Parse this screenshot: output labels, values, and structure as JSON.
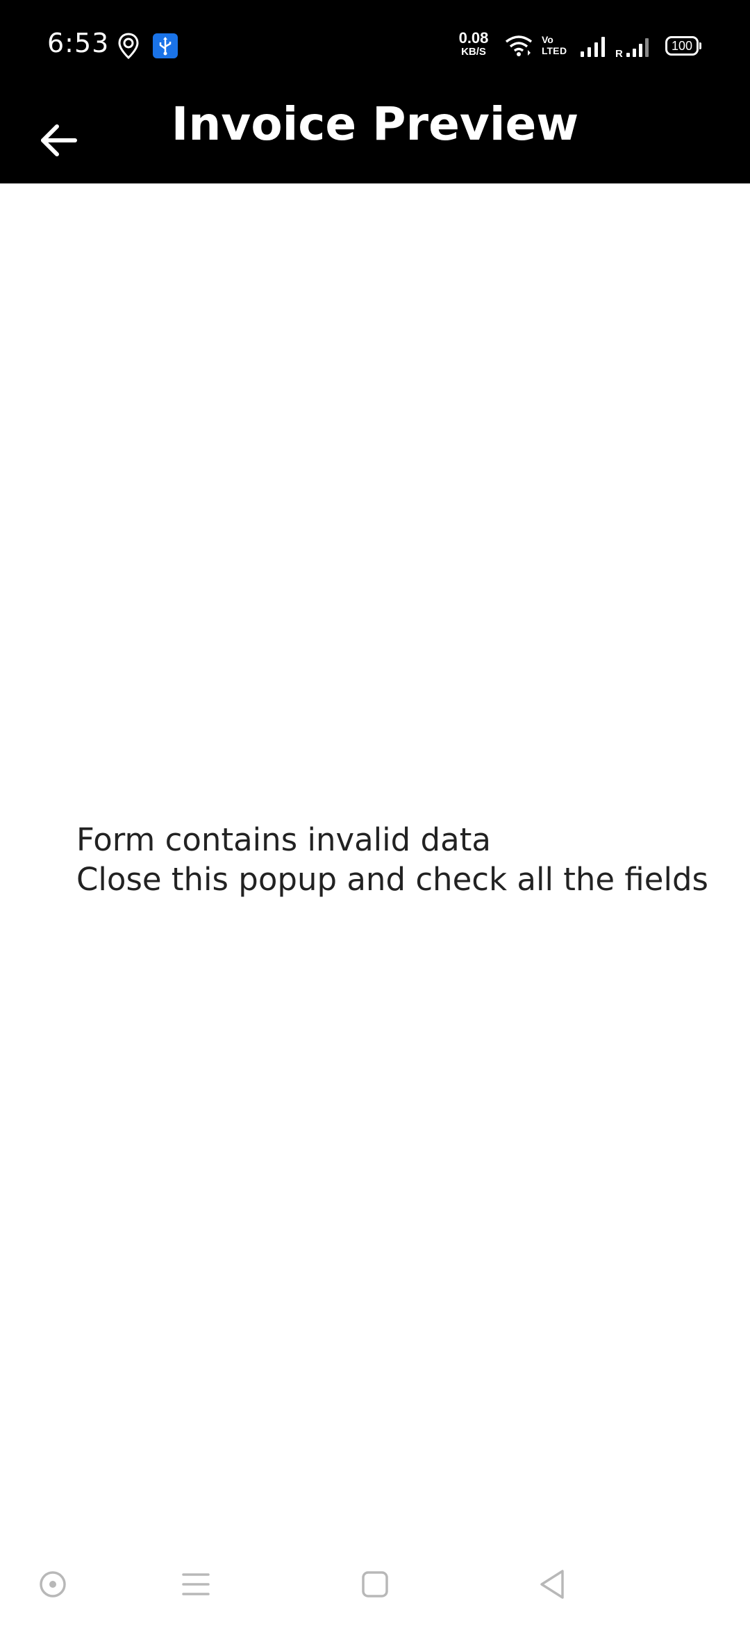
{
  "status_bar": {
    "time": "6:53",
    "net_speed_value": "0.08",
    "net_speed_unit": "KB/S",
    "volte_label": "Vo LTE",
    "battery_level": "100",
    "icons": [
      "location-icon",
      "usb-icon",
      "wifi-icon",
      "volte-icon",
      "signal-icon",
      "roaming-signal-icon",
      "battery-icon"
    ]
  },
  "app_bar": {
    "title": "Invoice Preview",
    "back_icon": "arrow-left-icon",
    "background": "#000000",
    "foreground": "#ffffff"
  },
  "message": {
    "line1": "Form contains invalid data",
    "line2": "Close this popup and check all the fields"
  },
  "nav_bar": {
    "icons": [
      "assistant-icon",
      "menu-icon",
      "home-icon",
      "back-icon"
    ]
  }
}
